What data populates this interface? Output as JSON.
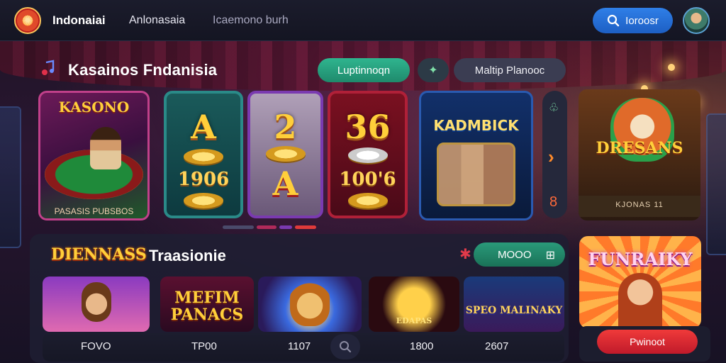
{
  "header": {
    "brand": "Indonaiai",
    "nav": [
      "Anlonasaia",
      "Icaemono burh"
    ],
    "search_label": "Ioroosr"
  },
  "section1": {
    "title": "Kasainos Fndanisia",
    "filter_green": "Luptinnoqn",
    "filter_gray": "Maltip Planooc",
    "cards": {
      "casino": {
        "title": "KASONO",
        "caption": "PASASIS PUBSBOS"
      },
      "slot_a": {
        "symbol": "A",
        "value": "1906"
      },
      "slot_2": {
        "symbol": "2",
        "symbol2": "A"
      },
      "slot_36": {
        "symbol": "36",
        "value": "100'6"
      },
      "kadmbick": {
        "title": "KADMBICK"
      },
      "dresans": {
        "title": "DRESANS",
        "caption": "KJONAS 11"
      }
    },
    "side_number": "8"
  },
  "section2": {
    "logo": "DIENNASS",
    "title": "Traasionie",
    "filter": "MOOO",
    "games": [
      {
        "title": ""
      },
      {
        "title": "MEFIM PANACS"
      },
      {
        "title": ""
      },
      {
        "title": "EDAPAS"
      },
      {
        "title": "SPEO MALINAKY"
      }
    ],
    "bottom_values": [
      "FOVO",
      "TP00",
      "1107",
      "1800",
      "2607"
    ]
  },
  "promo": {
    "title": "FUNRAIKY",
    "button": "Pwinoot"
  },
  "colors": {
    "accent_blue": "#2f7fe8",
    "accent_green": "#2fb58f",
    "accent_red": "#f03a3a"
  }
}
